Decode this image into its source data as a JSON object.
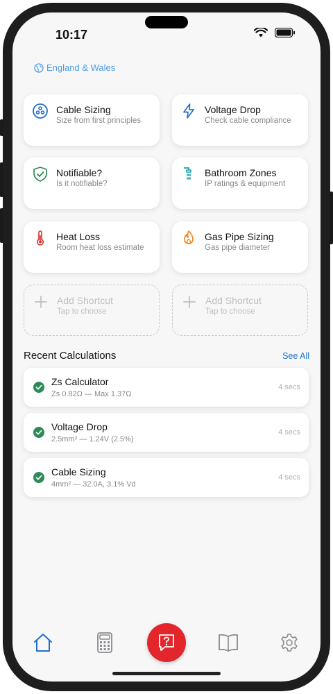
{
  "status": {
    "time": "10:17"
  },
  "region": {
    "label": "England & Wales"
  },
  "shortcuts": [
    {
      "title": "Cable Sizing",
      "subtitle": "Size from first principles",
      "icon": "cable-icon"
    },
    {
      "title": "Voltage Drop",
      "subtitle": "Check cable compliance",
      "icon": "lightning-icon"
    },
    {
      "title": "Notifiable?",
      "subtitle": "Is it notifiable?",
      "icon": "shield-check-icon"
    },
    {
      "title": "Bathroom Zones",
      "subtitle": "IP ratings & equipment",
      "icon": "shower-icon"
    },
    {
      "title": "Heat Loss",
      "subtitle": "Room heat loss estimate",
      "icon": "thermometer-icon"
    },
    {
      "title": "Gas Pipe Sizing",
      "subtitle": "Gas pipe diameter",
      "icon": "flame-icon"
    }
  ],
  "empty_shortcuts": [
    {
      "title": "Add Shortcut",
      "subtitle": "Tap to choose"
    },
    {
      "title": "Add Shortcut",
      "subtitle": "Tap to choose"
    }
  ],
  "recent": {
    "title": "Recent Calculations",
    "see_all": "See All",
    "items": [
      {
        "title": "Zs Calculator",
        "detail": "Zs 0.82Ω — Max 1.37Ω",
        "time": "4 secs"
      },
      {
        "title": "Voltage Drop",
        "detail": "2.5mm² — 1.24V (2.5%)",
        "time": "4 secs"
      },
      {
        "title": "Cable Sizing",
        "detail": "4mm² — 32.0A, 3.1% Vd",
        "time": "4 secs"
      }
    ]
  },
  "tabs": [
    "home-icon",
    "calculator-icon",
    "help-icon",
    "book-icon",
    "gear-icon"
  ],
  "colors": {
    "accent": "#1f6fcf",
    "fab": "#e3262b",
    "success": "#2e8b57",
    "flame": "#f08a1c",
    "thermo": "#d8322e",
    "shower": "#1aa0a8"
  }
}
